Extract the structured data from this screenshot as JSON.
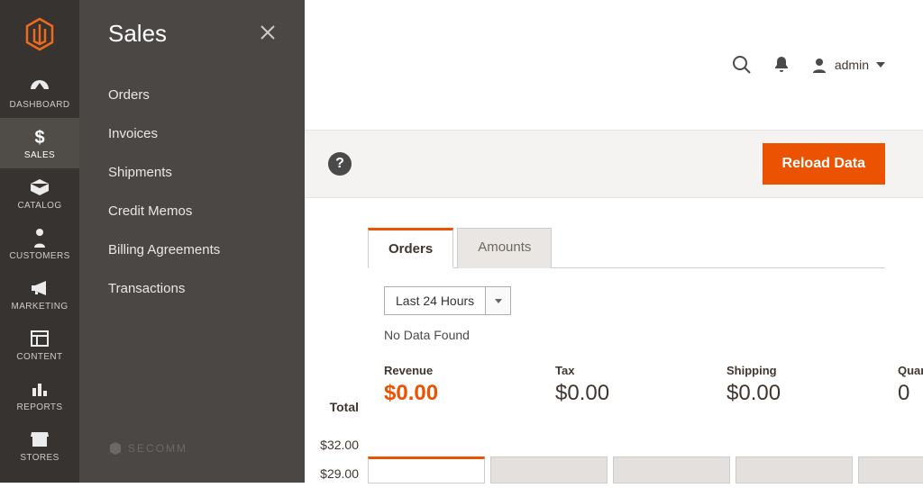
{
  "nav": {
    "items": [
      {
        "label": "DASHBOARD"
      },
      {
        "label": "SALES"
      },
      {
        "label": "CATALOG"
      },
      {
        "label": "CUSTOMERS"
      },
      {
        "label": "MARKETING"
      },
      {
        "label": "CONTENT"
      },
      {
        "label": "REPORTS"
      },
      {
        "label": "STORES"
      }
    ]
  },
  "flyout": {
    "title": "Sales",
    "items": [
      "Orders",
      "Invoices",
      "Shipments",
      "Credit Memos",
      "Billing Agreements",
      "Transactions"
    ]
  },
  "watermark": "SECOMM",
  "topbar": {
    "user": "admin"
  },
  "action": {
    "reload": "Reload Data"
  },
  "dash": {
    "tabs": {
      "orders": "Orders",
      "amounts": "Amounts"
    },
    "range": "Last 24 Hours",
    "nodata": "No Data Found",
    "metrics": {
      "revenue_label": "Revenue",
      "revenue_value": "$0.00",
      "tax_label": "Tax",
      "tax_value": "$0.00",
      "shipping_label": "Shipping",
      "shipping_value": "$0.00",
      "quantity_label": "Quantity",
      "quantity_value": "0"
    },
    "sidecol": {
      "header": "Total",
      "row1": "$32.00",
      "row2": "$29.00"
    }
  }
}
